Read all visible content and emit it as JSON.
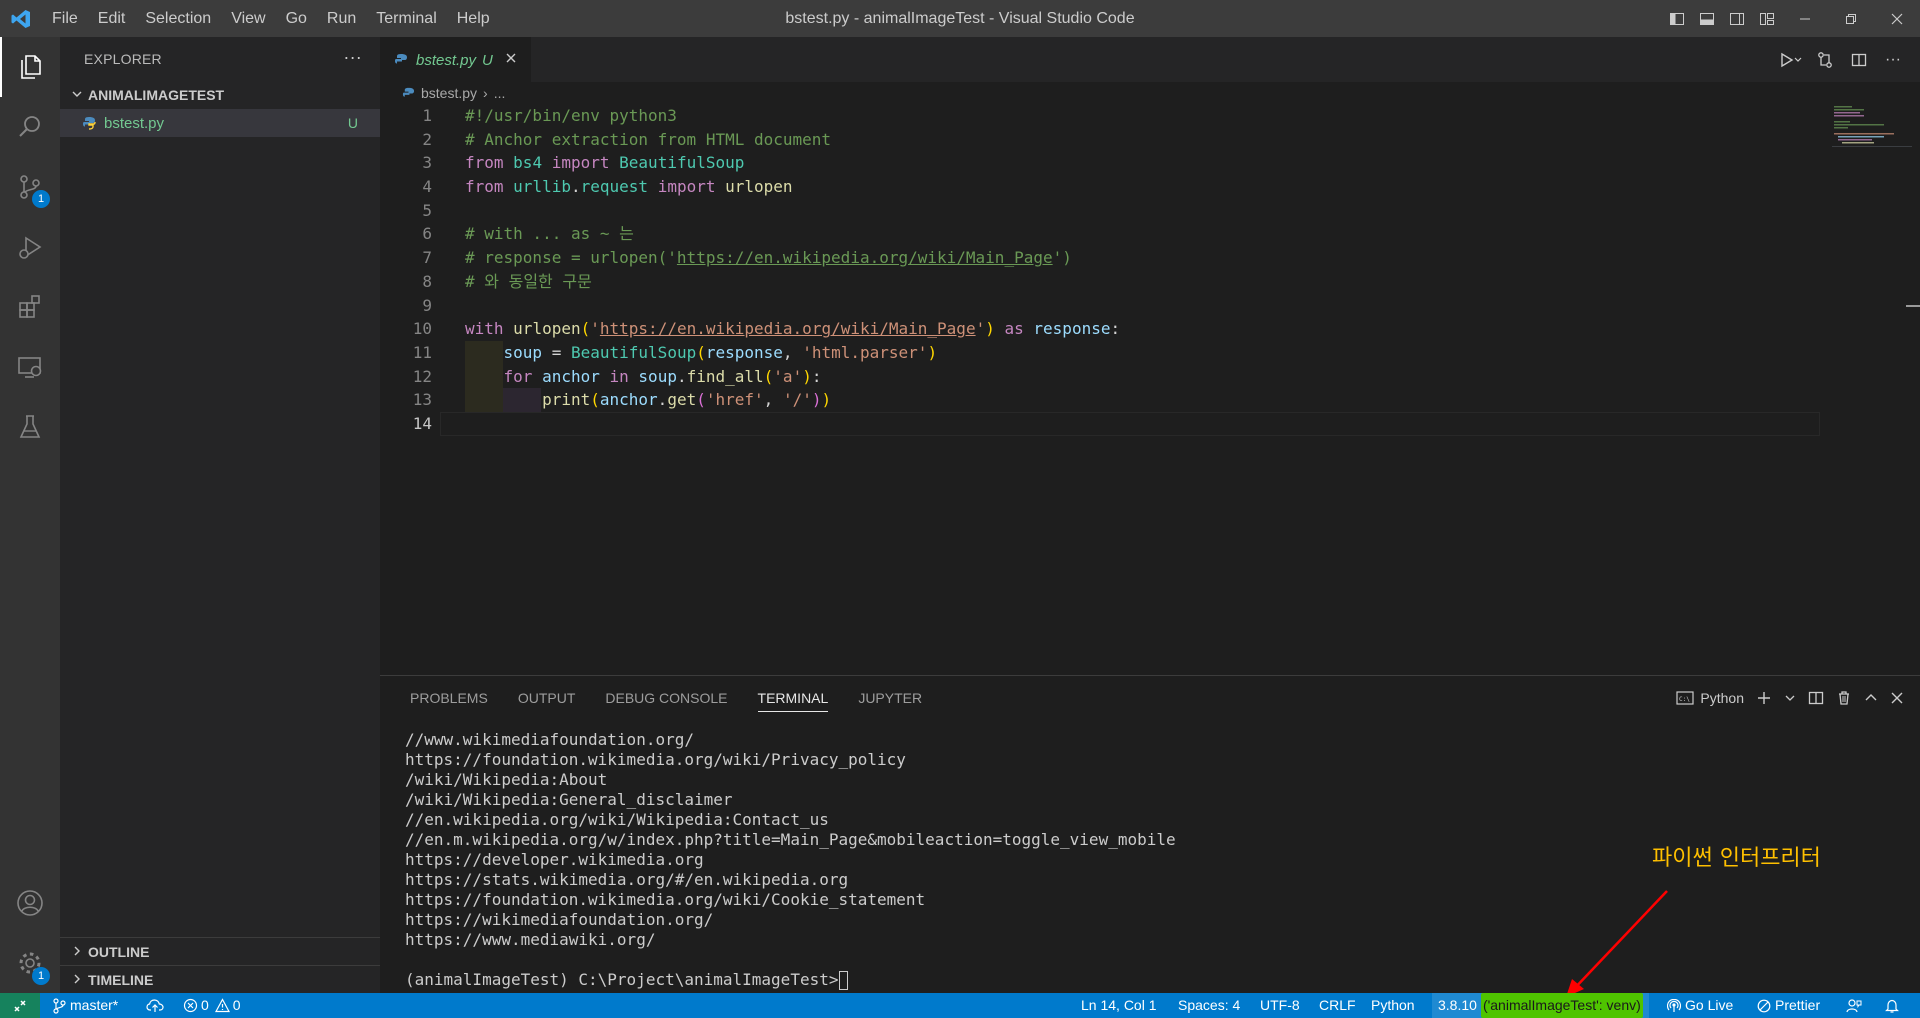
{
  "window": {
    "title": "bstest.py - animalImageTest - Visual Studio Code"
  },
  "menu": [
    "File",
    "Edit",
    "Selection",
    "View",
    "Go",
    "Run",
    "Terminal",
    "Help"
  ],
  "activity_bar": {
    "scm_badge": "1",
    "accounts_badge": "1"
  },
  "sidebar": {
    "header": "EXPLORER",
    "more": "···",
    "folder": "ANIMALIMAGETEST",
    "files": [
      {
        "name": "bstest.py",
        "status": "U"
      }
    ],
    "outline": "OUTLINE",
    "timeline": "TIMELINE"
  },
  "editor": {
    "tab": {
      "name": "bstest.py",
      "status": "U"
    },
    "breadcrumb": {
      "file": "bstest.py",
      "rest": "..."
    },
    "line_numbers": [
      "1",
      "2",
      "3",
      "4",
      "5",
      "6",
      "7",
      "8",
      "9",
      "10",
      "11",
      "12",
      "13",
      "14"
    ]
  },
  "panel": {
    "tabs": [
      "PROBLEMS",
      "OUTPUT",
      "DEBUG CONSOLE",
      "TERMINAL",
      "JUPYTER"
    ],
    "active_tab": "TERMINAL",
    "shell": "Python",
    "terminal_lines": [
      "//www.wikimediafoundation.org/",
      "https://foundation.wikimedia.org/wiki/Privacy_policy",
      "/wiki/Wikipedia:About",
      "/wiki/Wikipedia:General_disclaimer",
      "//en.wikipedia.org/wiki/Wikipedia:Contact_us",
      "//en.m.wikipedia.org/w/index.php?title=Main_Page&mobileaction=toggle_view_mobile",
      "https://developer.wikimedia.org",
      "https://stats.wikimedia.org/#/en.wikipedia.org",
      "https://foundation.wikimedia.org/wiki/Cookie_statement",
      "https://wikimediafoundation.org/",
      "https://www.mediawiki.org/"
    ],
    "prompt": "(animalImageTest) C:\\Project\\animalImageTest>"
  },
  "annotation": "파이썬 인터프리터",
  "statusbar": {
    "branch": "master*",
    "errors": "0",
    "warnings": "0",
    "position": "Ln 14, Col 1",
    "spaces": "Spaces: 4",
    "encoding": "UTF-8",
    "eol": "CRLF",
    "language": "Python",
    "interpreter_version": "3.8.10",
    "interpreter_env": "('animalImageTest': venv)",
    "go_live": "Go Live",
    "prettier": "Prettier"
  },
  "colors": {
    "statusbar": "#007acc",
    "remote": "#16825d",
    "annotation": "#ffc000",
    "arrow": "#ff0000",
    "untracked": "#73c991"
  },
  "icons": {
    "activity": [
      "explorer-icon",
      "search-icon",
      "source-control-icon",
      "run-debug-icon",
      "extensions-icon",
      "remote-explorer-icon",
      "testing-icon",
      "accounts-icon",
      "manage-gear-icon"
    ]
  }
}
